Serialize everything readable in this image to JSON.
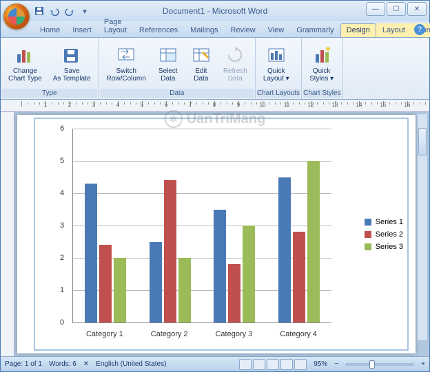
{
  "title": "Document1 - Microsoft Word",
  "qat": [
    "save",
    "undo",
    "redo"
  ],
  "tabs": [
    {
      "label": "Home"
    },
    {
      "label": "Insert"
    },
    {
      "label": "Page Layout"
    },
    {
      "label": "References"
    },
    {
      "label": "Mailings"
    },
    {
      "label": "Review"
    },
    {
      "label": "View"
    },
    {
      "label": "Grammarly"
    },
    {
      "label": "Design",
      "active": true,
      "highlight": true
    },
    {
      "label": "Layout",
      "highlight": true
    },
    {
      "label": "Format",
      "highlight": true
    }
  ],
  "ribbon": {
    "groups": [
      {
        "label": "Type",
        "buttons": [
          {
            "label": "Change Chart Type",
            "icon": "chart-type"
          },
          {
            "label": "Save As Template",
            "icon": "save-template"
          }
        ]
      },
      {
        "label": "Data",
        "buttons": [
          {
            "label": "Switch Row/Column",
            "icon": "switch"
          },
          {
            "label": "Select Data",
            "icon": "select-data"
          },
          {
            "label": "Edit Data",
            "icon": "edit-data"
          },
          {
            "label": "Refresh Data",
            "icon": "refresh",
            "disabled": true
          }
        ]
      },
      {
        "label": "Chart Layouts",
        "buttons": [
          {
            "label": "Quick Layout ▾",
            "icon": "quick-layout"
          }
        ]
      },
      {
        "label": "Chart Styles",
        "buttons": [
          {
            "label": "Quick Styles ▾",
            "icon": "quick-styles"
          }
        ]
      }
    ]
  },
  "status": {
    "page": "Page: 1 of 1",
    "words": "Words: 6",
    "language": "English (United States)",
    "zoom": "95%"
  },
  "watermark": "UanTriMang",
  "chart_data": {
    "type": "bar",
    "categories": [
      "Category 1",
      "Category 2",
      "Category 3",
      "Category 4"
    ],
    "series": [
      {
        "name": "Series 1",
        "color": "#4a7ab5",
        "values": [
          4.3,
          2.5,
          3.5,
          4.5
        ]
      },
      {
        "name": "Series 2",
        "color": "#c0504d",
        "values": [
          2.4,
          4.4,
          1.8,
          2.8
        ]
      },
      {
        "name": "Series 3",
        "color": "#9bbb59",
        "values": [
          2.0,
          2.0,
          3.0,
          5.0
        ]
      }
    ],
    "ylim": [
      0,
      6
    ],
    "yticks": [
      0,
      1,
      2,
      3,
      4,
      5,
      6
    ]
  }
}
